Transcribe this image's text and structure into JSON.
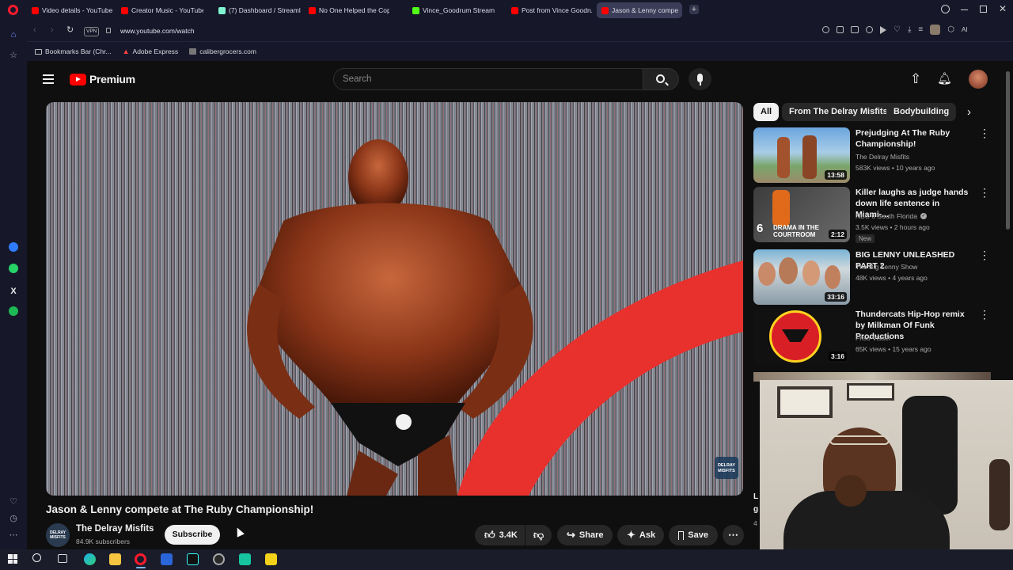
{
  "browser": {
    "tabs": [
      {
        "label": "Video details - YouTube S",
        "color": "#ff0000"
      },
      {
        "label": "Creator Music - YouTube S",
        "color": "#ff0000"
      },
      {
        "label": "(7) Dashboard / Streamlab",
        "color": "#80f5d2"
      },
      {
        "label": "No One Helped the Cop?!",
        "color": "#ff0000"
      },
      {
        "label": "Vince_Goodrum Stream",
        "color": "#53fc18"
      },
      {
        "label": "Post from Vince Goodrum",
        "color": "#ff0000"
      },
      {
        "label": "Jason & Lenny compe",
        "color": "#ff0000"
      }
    ],
    "vpn_label": "VPN",
    "url": "www.youtube.com/watch",
    "bookmarks": [
      {
        "label": "Bookmarks Bar (Chr...",
        "icon": "folder-icon"
      },
      {
        "label": "Adobe Express",
        "icon": "adobe-icon"
      },
      {
        "label": "calibergrocers.com",
        "icon": "store-icon"
      }
    ]
  },
  "youtube": {
    "brand": "Premium",
    "search_placeholder": "Search",
    "chips": [
      "All",
      "From The Delray Misfits",
      "Bodybuilding"
    ],
    "video": {
      "title": "Jason & Lenny compete at The Ruby Championship!",
      "watermark": "DELRAY MISFITS",
      "channel": "The Delray Misfits",
      "subscribers": "84.9K subscribers",
      "channel_avatar_text": "DELRAY MISFITS",
      "subscribe_label": "Subscribe",
      "likes": "3.4K",
      "share_label": "Share",
      "ask_label": "Ask",
      "save_label": "Save"
    },
    "recommended": [
      {
        "title": "Prejudging At The Ruby Championship!",
        "channel": "The Delray Misfits",
        "meta": "583K views • 10 years ago",
        "duration": "13:58",
        "badge": ""
      },
      {
        "title": "Killer laughs as judge hands down life sentence in Miami-...",
        "channel": "NBC 6 South Florida",
        "meta": "3.5K views • 2 hours ago",
        "duration": "2:12",
        "badge": "New",
        "thumb_text_num": "6",
        "thumb_text": "DRAMA IN THE COURTROOM"
      },
      {
        "title": "BIG LENNY UNLEASHED PART 2",
        "channel": "The Big Lenny Show",
        "meta": "48K views • 4 years ago",
        "duration": "33:16",
        "badge": ""
      },
      {
        "title": "Thundercats Hip-Hop remix by Milkman Of Funk Productions",
        "channel": "Friso Visser",
        "meta": "65K views • 15 years ago",
        "duration": "3:16",
        "badge": ""
      }
    ],
    "partial_texts": [
      "L",
      "g",
      "4"
    ]
  },
  "colors": {
    "accent_red": "#ff0000",
    "yt_bg": "#0f0f0f",
    "chip_bg": "#272727",
    "browser_bg": "#16182a"
  }
}
